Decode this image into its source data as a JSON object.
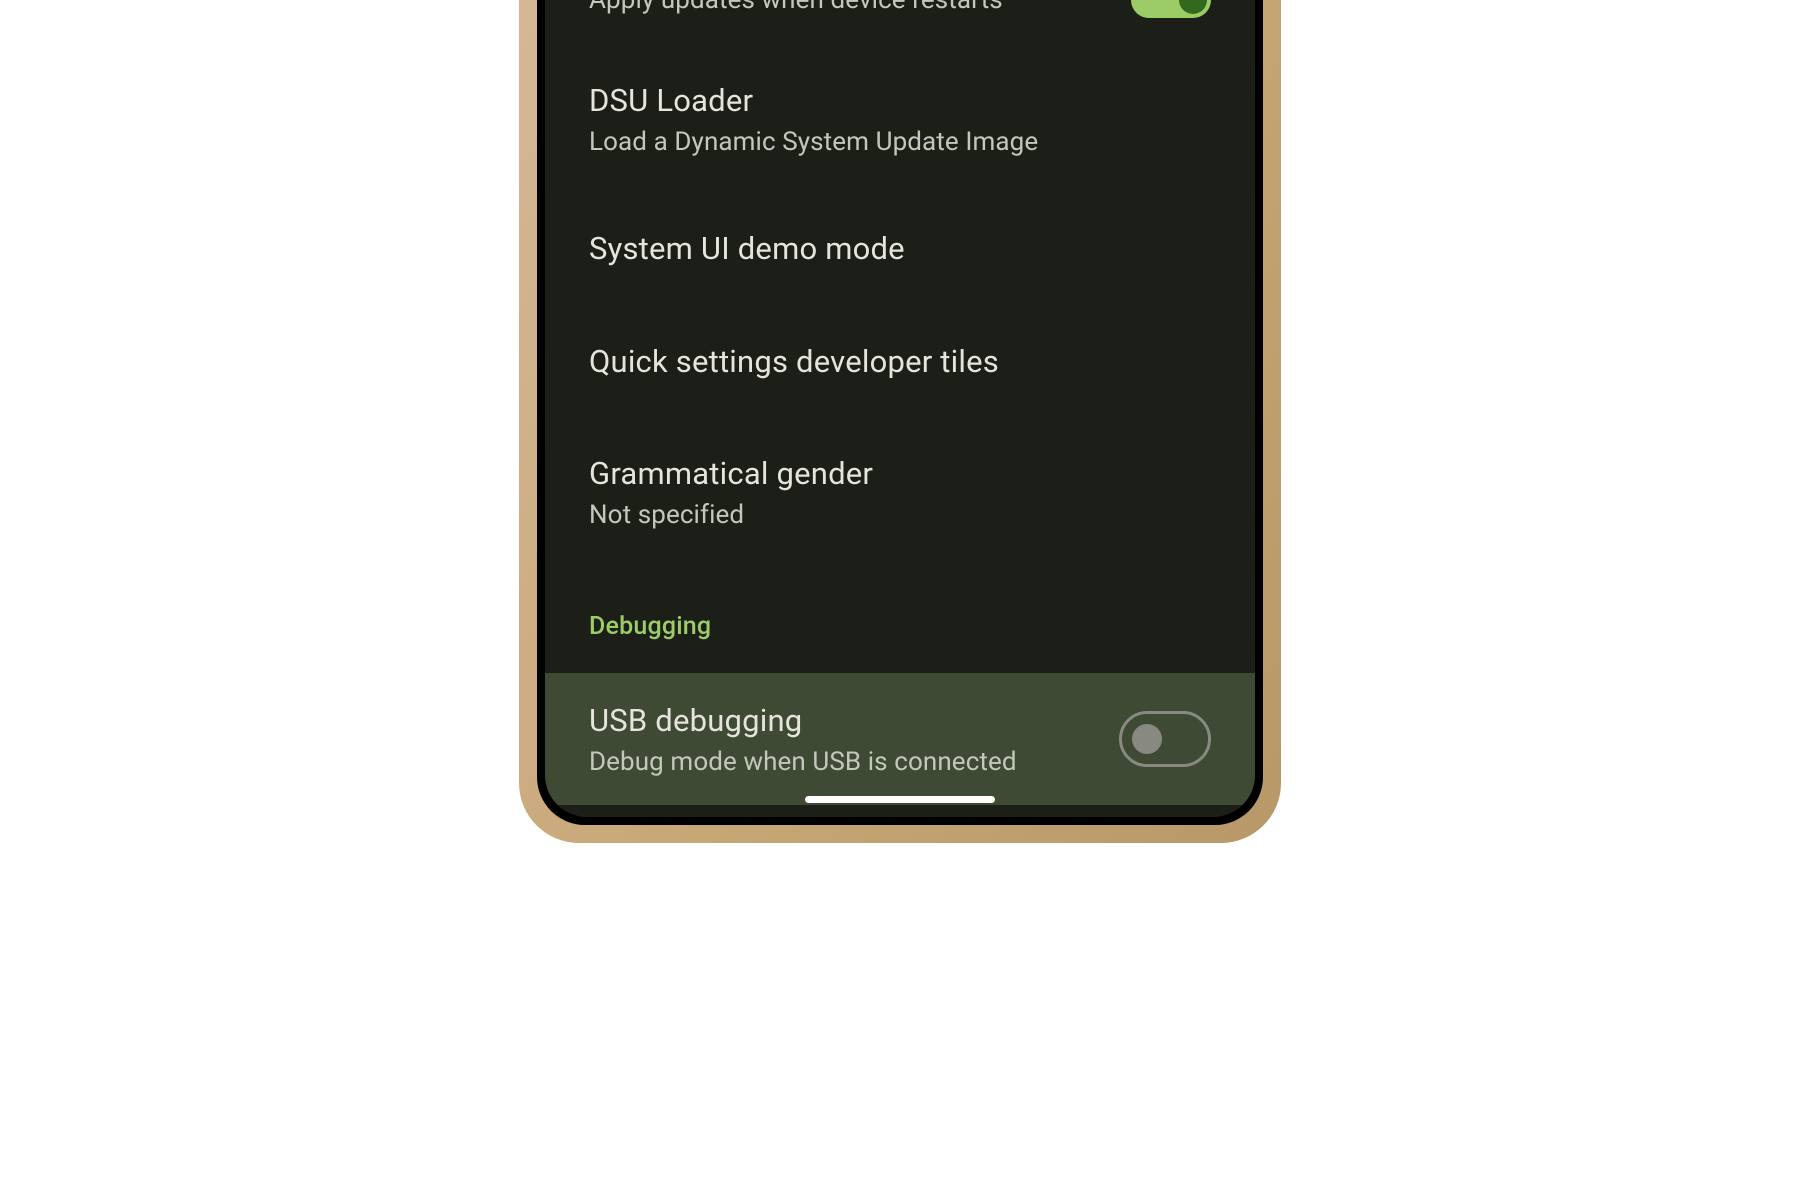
{
  "settings": {
    "apply_updates": {
      "subtitle": "Apply updates when device restarts",
      "toggle_state": "on"
    },
    "dsu_loader": {
      "title": "DSU Loader",
      "subtitle": "Load a Dynamic System Update Image"
    },
    "demo_mode": {
      "title": "System UI demo mode"
    },
    "quick_settings": {
      "title": "Quick settings developer tiles"
    },
    "grammatical_gender": {
      "title": "Grammatical gender",
      "subtitle": "Not specified"
    },
    "section_debugging": "Debugging",
    "usb_debugging": {
      "title": "USB debugging",
      "subtitle": "Debug mode when USB is connected",
      "toggle_state": "off"
    }
  }
}
